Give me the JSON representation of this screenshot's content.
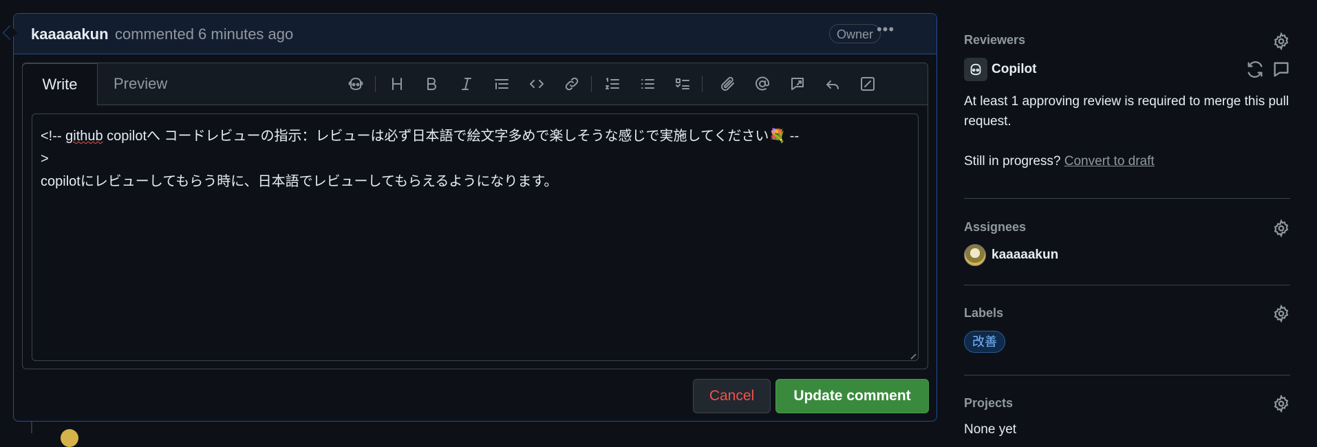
{
  "comment": {
    "author": "kaaaaakun",
    "action": "commented 6 minutes ago",
    "badge": "Owner"
  },
  "editor": {
    "tabs": [
      "Write",
      "Preview"
    ],
    "content_line1_pre": "<!-- ",
    "content_line1_word": "github",
    "content_line1_post": " copilotへ コードレビューの指示：レビューは必ず日本語で絵文字多めで楽しそうな感じで実施してください💐 --",
    "content_line2": ">",
    "content_line3": "copilotにレビューしてもらう時に、日本語でレビューしてもらえるようになります。",
    "toolbar_icons": [
      "copilot-icon",
      "heading-icon",
      "bold-icon",
      "italic-icon",
      "quote-icon",
      "code-icon",
      "link-icon",
      "ordered-list-icon",
      "unordered-list-icon",
      "task-list-icon",
      "attach-icon",
      "mention-icon",
      "reference-icon",
      "reply-icon",
      "fullscreen-icon"
    ]
  },
  "buttons": {
    "cancel": "Cancel",
    "update": "Update comment"
  },
  "sidebar": {
    "reviewers": {
      "title": "Reviewers",
      "reviewer": "Copilot",
      "note": "At least 1 approving review is required to merge this pull request.",
      "progress_prefix": "Still in progress?",
      "progress_link": "Convert to draft"
    },
    "assignees": {
      "title": "Assignees",
      "user": "kaaaaakun"
    },
    "labels": {
      "title": "Labels",
      "label": "改善",
      "label_color": "#0f2a4a"
    },
    "projects": {
      "title": "Projects",
      "value": "None yet"
    }
  },
  "colors": {
    "accent_green": "#3a8a3e",
    "danger": "#f85149",
    "border_active": "#1f4f91"
  }
}
